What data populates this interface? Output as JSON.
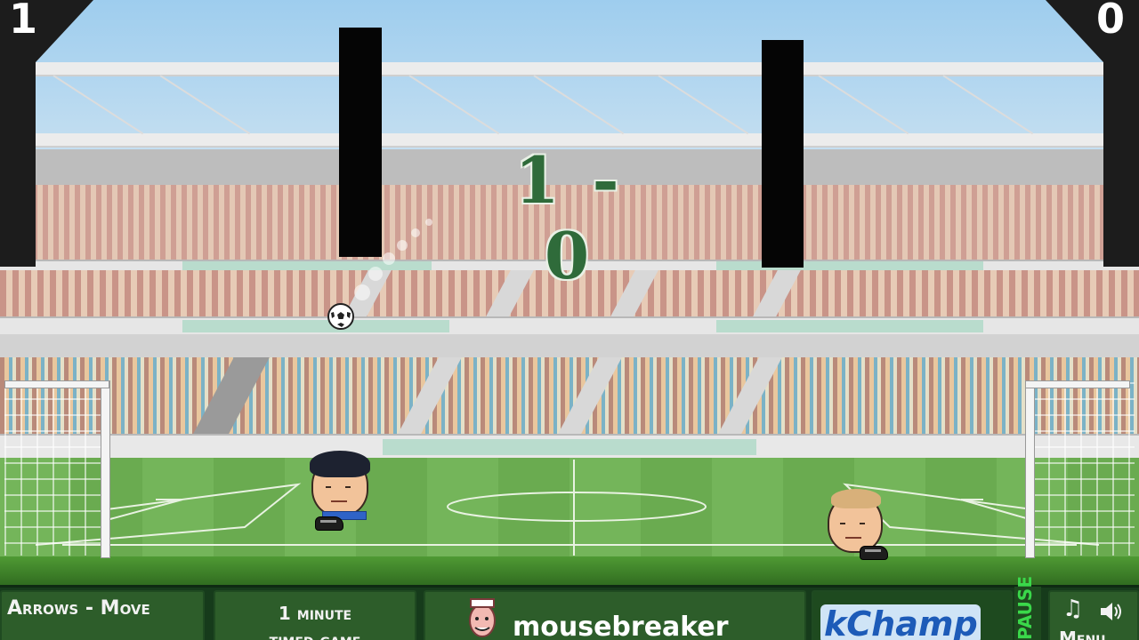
{
  "scoreboard": {
    "left_score": "1",
    "right_score": "0",
    "center_score": "1 - 0"
  },
  "hud": {
    "controls_line1": "Arrows - Move",
    "controls_line2": "",
    "mode_line1": "1 minute",
    "mode_line2": "timed game",
    "sponsor1": "mousebreaker",
    "sponsor2": "kChamp",
    "pause_label": "PAUSE",
    "menu_label": "Menu"
  },
  "icons": {
    "music": "music-note-icon",
    "sound": "speaker-icon"
  },
  "colors": {
    "hud_bg": "#163b1b",
    "hud_panel": "#2d5d2a",
    "score_green": "#2f6b3a",
    "pause_green": "#3ad84a"
  }
}
